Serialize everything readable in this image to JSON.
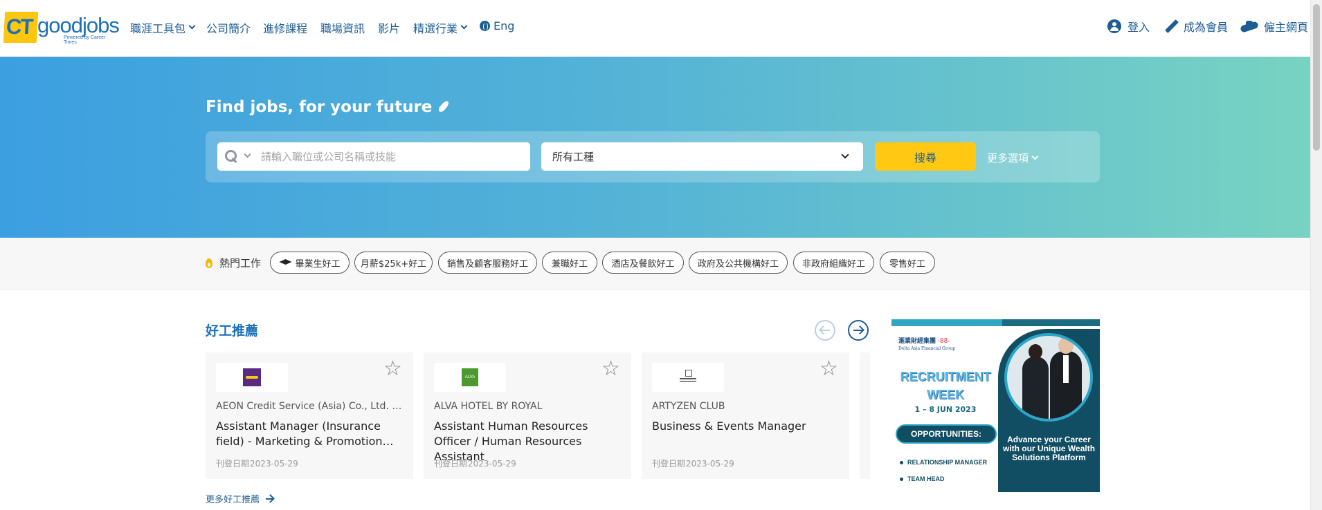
{
  "header": {
    "logo": {
      "ct": "CT",
      "goodjobs": "goodjobs",
      "powered": "Powered by Career Times"
    },
    "nav": {
      "toolkit": "職涯工具包",
      "about": "公司簡介",
      "courses": "進修課程",
      "info": "職場資訊",
      "videos": "影片",
      "industries": "精選行業",
      "lang": "Eng"
    },
    "right": {
      "login": "登入",
      "register": "成為會員",
      "employer": "僱主網頁"
    }
  },
  "hero": {
    "title": "Find jobs, for your future",
    "search": {
      "placeholder": "請輸入職位或公司名稱或技能",
      "category": "所有工種",
      "button": "搜尋",
      "more": "更多選項"
    }
  },
  "hot": {
    "label": "熱門工作",
    "tags": [
      "畢業生好工",
      "月薪$25k+好工",
      "銷售及顧客服務好工",
      "兼職好工",
      "酒店及餐飲好工",
      "政府及公共機構好工",
      "非政府組織好工",
      "零售好工"
    ]
  },
  "recommend": {
    "title": "好工推薦",
    "date_label": "刊登日期",
    "more": "更多好工推薦",
    "cards": [
      {
        "company": "AEON Credit Service (Asia) Co., Ltd. (AEON)",
        "title": "Assistant Manager (Insurance field) - Marketing & Promotion…",
        "date": "2023-05-29",
        "logo_icon": "aeon-logo"
      },
      {
        "company": "ALVA HOTEL BY ROYAL",
        "title": "Assistant Human Resources Officer / Human Resources Assistant",
        "date": "2023-05-29",
        "logo_icon": "alva-logo",
        "logo_text": "ALVA"
      },
      {
        "company": "ARTYZEN CLUB",
        "title": "Business & Events Manager",
        "date": "2023-05-29",
        "logo_icon": "artyzen-logo"
      }
    ]
  },
  "ad": {
    "brand_cn": "滙業財經集團",
    "brand_en": "Delta Asia Financial Group",
    "brand_num": "-88-",
    "headline_1": "RECRUITMENT",
    "headline_2": "WEEK",
    "dates": "1 – 8 JUN 2023",
    "opportunities": "OPPORTUNITIES:",
    "roles": [
      "RELATIONSHIP MANAGER",
      "TEAM HEAD"
    ],
    "tagline": "Advance your Career with our Unique Wealth Solutions Platform"
  },
  "colors": {
    "brand_blue": "#1d5d93",
    "brand_yellow": "#fcc70e",
    "search_button": "#ffc813",
    "hero_left": "#3c9fe0",
    "hero_right": "#78d3c2"
  }
}
